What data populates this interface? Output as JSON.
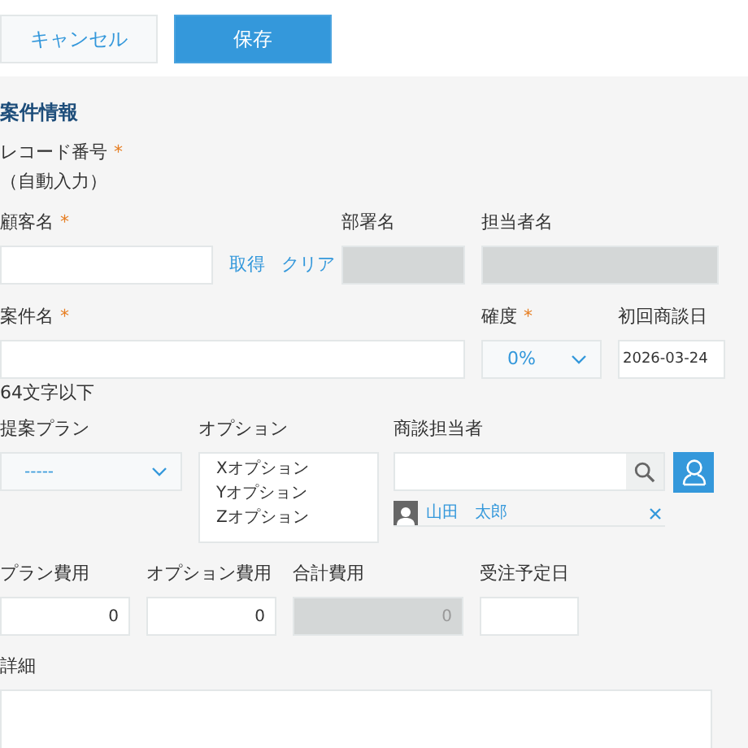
{
  "toolbar": {
    "cancel": "キャンセル",
    "save": "保存"
  },
  "section_title": "案件情報",
  "record_number": {
    "label": "レコード番号",
    "required_mark": "*",
    "value": "（自動入力）"
  },
  "customer": {
    "label": "顧客名",
    "required_mark": "*",
    "links": [
      "取得",
      "クリア"
    ]
  },
  "department": {
    "label": "部署名"
  },
  "person_in_charge": {
    "label": "担当者名"
  },
  "deal_name": {
    "label": "案件名",
    "required_mark": "*",
    "hint": "64文字以下"
  },
  "probability": {
    "label": "確度",
    "required_mark": "*",
    "value": "0%"
  },
  "first_meeting": {
    "label": "初回商談日",
    "value": "2026-03-24"
  },
  "plan": {
    "label": "提案プラン",
    "value": "-----"
  },
  "options": {
    "label": "オプション",
    "items": [
      "Xオプション",
      "Yオプション",
      "Zオプション"
    ]
  },
  "sales_rep": {
    "label": "商談担当者",
    "users": [
      "山田　太郎"
    ]
  },
  "costs": [
    {
      "label": "プラン費用",
      "value": "0",
      "disabled": false
    },
    {
      "label": "オプション費用",
      "value": "0",
      "disabled": false
    },
    {
      "label": "合計費用",
      "value": "0",
      "disabled": true
    }
  ],
  "order_date": {
    "label": "受注予定日"
  },
  "details": {
    "label": "詳細"
  }
}
